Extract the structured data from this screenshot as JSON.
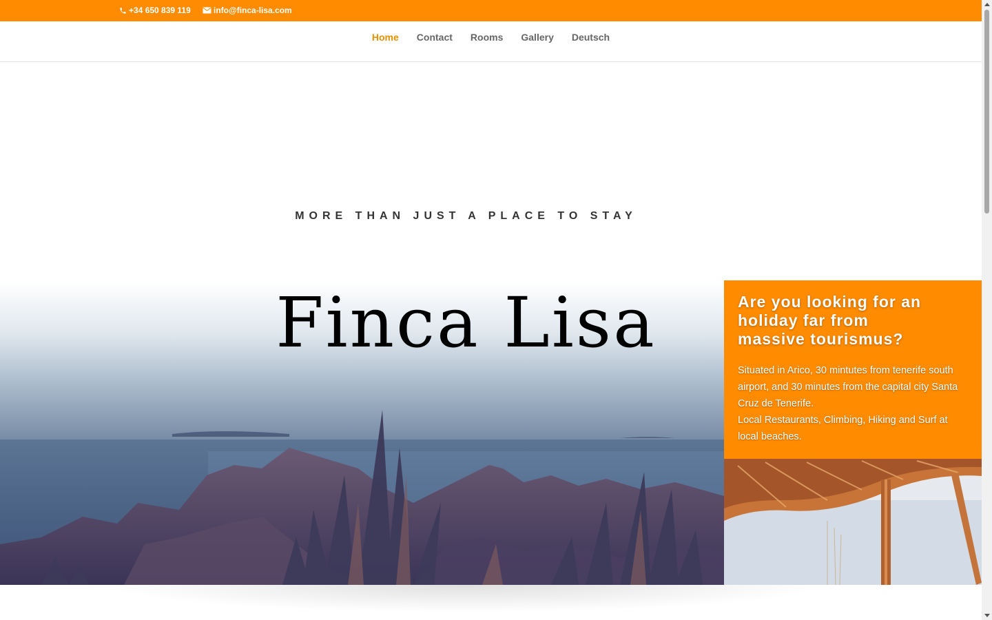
{
  "topbar": {
    "phone": "+34 650 839 119",
    "email": "info@finca-lisa.com",
    "phone_icon": "phone-icon",
    "email_icon": "envelope-icon",
    "background": "#ff8c00"
  },
  "nav": {
    "items": [
      {
        "label": "Home",
        "active": true
      },
      {
        "label": "Contact",
        "active": false
      },
      {
        "label": "Rooms",
        "active": false
      },
      {
        "label": "Gallery",
        "active": false
      },
      {
        "label": "Deutsch",
        "active": false
      }
    ],
    "active_color": "#e89000"
  },
  "hero": {
    "subtitle": "MORE THAN JUST A PLACE TO STAY",
    "title": "Finca Lisa"
  },
  "info_card": {
    "heading": "Are you looking for an holiday far from massive tourismus?",
    "paragraph1": "Situated in Arico, 30 mintutes from tenerife south airport, and 30 minutes from the capital city Santa Cruz de Tenerife.",
    "paragraph2": "Local Restaurants, Climbing, Hiking and Surf at local beaches.",
    "background": "#ff8c00"
  }
}
